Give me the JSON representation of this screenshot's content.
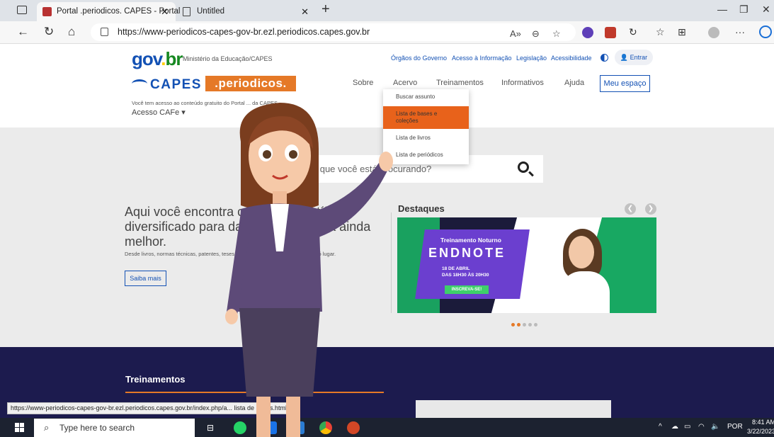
{
  "browser": {
    "tabs": [
      {
        "title": "Portal .periodicos. CAPES - Portal",
        "active": true
      },
      {
        "title": "Untitled",
        "active": false
      }
    ],
    "url": "https://www-periodicos-capes-gov-br.ezl.periodicos.capes.gov.br",
    "status_url": "https://www-periodicos-capes-gov-br.ezl.periodicos.capes.gov.br/index.php/a... lista de bases.html"
  },
  "gov": {
    "logo": "gov.br",
    "ministerio": "Ministério da Educação/CAPES",
    "links": [
      "Órgãos do Governo",
      "Acesso à Informação",
      "Legislação",
      "Acessibilidade"
    ],
    "entrar": "Entrar"
  },
  "site": {
    "capes": "CAPES",
    "periodicos": ".periodicos.",
    "menu": [
      "Sobre",
      "Acervo",
      "Treinamentos",
      "Informativos",
      "Ajuda"
    ],
    "meu_espaco": "Meu espaço",
    "acesso_text": "Você tem acesso ao conteúdo gratuito do Portal ... da CAPES",
    "acesso_cafe": "Acesso CAFe ▾"
  },
  "dropdown": {
    "items": [
      "Buscar assunto",
      "Lista de bases e coleções",
      "Lista de livros",
      "Lista de periódicos"
    ]
  },
  "hero": {
    "search_placeholder": "O que você está procurando?",
    "title": "Aqui você encontra conteúdo científico diversificado para dar à sua pesquisa ainda melhor.",
    "subtitle": "Desde livros, normas técnicas, patentes, teses, vídeos e áudios reunidos em um só lugar.",
    "saiba_mais": "Saiba mais",
    "destaques": "Destaques"
  },
  "banner": {
    "line1": "Treinamento Noturno",
    "line2": "ENDNOTE",
    "line3a": "18 DE ABRIL",
    "line3b": "DAS 18H30 ÀS 20H30",
    "button": "INSCREVA-SE!"
  },
  "section": {
    "treinamentos": "Treinamentos"
  },
  "taskbar": {
    "search": "Type here to search",
    "lang": "POR",
    "time": "8:41 AM",
    "date": "3/22/2023"
  },
  "colors": {
    "brand_blue": "#1351b4",
    "orange": "#e8621b",
    "dark_section": "#1c1b4e",
    "banner_purple": "#6b3fcf",
    "banner_green": "#18a862"
  }
}
